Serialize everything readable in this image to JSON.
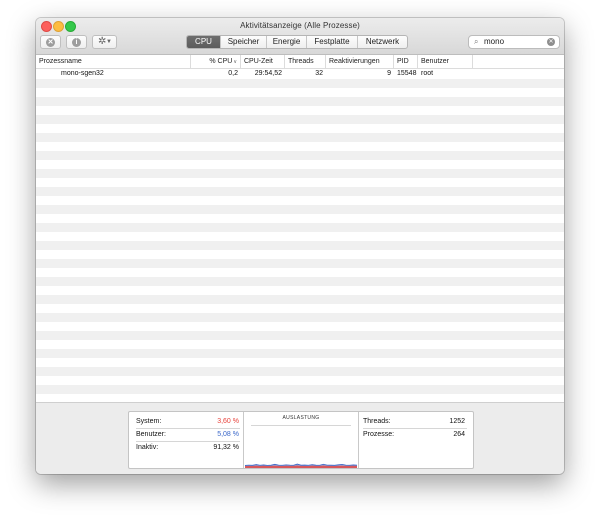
{
  "window": {
    "title": "Aktivitätsanzeige (Alle Prozesse)"
  },
  "toolbar": {
    "close_process_icon": "close-x",
    "info_icon": "i",
    "gear_icon": "gear",
    "tabs": [
      {
        "label": "CPU",
        "active": true
      },
      {
        "label": "Speicher",
        "active": false
      },
      {
        "label": "Energie",
        "active": false
      },
      {
        "label": "Festplatte",
        "active": false
      },
      {
        "label": "Netzwerk",
        "active": false
      }
    ],
    "search": {
      "value": "mono"
    }
  },
  "table": {
    "columns": [
      "Prozessname",
      "% CPU",
      "CPU-Zeit",
      "Threads",
      "Reaktivierungen",
      "PID",
      "Benutzer"
    ],
    "rows": [
      {
        "name": "mono-sgen32",
        "cpu": "0,2",
        "cpu_time": "29:54,52",
        "threads": "32",
        "reactivations": "9",
        "pid": "15548",
        "user": "root"
      }
    ]
  },
  "stats": {
    "system_label": "System:",
    "system_value": "3,60 %",
    "user_label": "Benutzer:",
    "user_value": "5,08 %",
    "idle_label": "Inaktiv:",
    "idle_value": "91,32 %",
    "graph_title": "AUSLASTUNG",
    "threads_label": "Threads:",
    "threads_value": "1252",
    "processes_label": "Prozesse:",
    "processes_value": "264"
  },
  "colors": {
    "system": "#e8423b",
    "user": "#3a67c9"
  },
  "chart_data": {
    "type": "area",
    "x": [
      0,
      1,
      2,
      3,
      4,
      5,
      6,
      7,
      8,
      9,
      10,
      11,
      12,
      13,
      14,
      15,
      16,
      17,
      18,
      19,
      20,
      21,
      22,
      23,
      24,
      25,
      26,
      27,
      28,
      29,
      30
    ],
    "series": [
      {
        "name": "System",
        "values": [
          3,
          3.5,
          3.2,
          4,
          3.4,
          3.8,
          3.3,
          3.6,
          4.2,
          3.5,
          3.4,
          3.9,
          3.6,
          3.5,
          4.4,
          3.6,
          3.7,
          3.4,
          4,
          3.6,
          3.5,
          4.3,
          3.7,
          3.6,
          3.4,
          3.9,
          4.1,
          3.7,
          3.5,
          3.8,
          3.6
        ]
      },
      {
        "name": "Benutzer",
        "values": [
          4.5,
          5.2,
          4.8,
          6.5,
          4.9,
          5.6,
          4.7,
          5.1,
          7,
          5.3,
          4.9,
          5.8,
          5.2,
          5.0,
          7.5,
          5.1,
          5.4,
          4.9,
          6.2,
          5.1,
          5.0,
          7.2,
          5.3,
          5.1,
          4.8,
          5.9,
          6.8,
          5.2,
          4.9,
          5.6,
          5.1
        ]
      }
    ],
    "ylim": [
      0,
      100
    ]
  }
}
